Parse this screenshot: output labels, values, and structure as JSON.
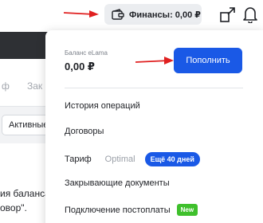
{
  "header": {
    "finance_label": "Финансы: 0,00 ₽"
  },
  "background": {
    "tabs": [
      "ф",
      "Зак"
    ],
    "filter_select": "Активные",
    "text_line_1": "ия баланса",
    "text_line_2": "овор\"."
  },
  "panel": {
    "balance_label": "Баланс eLama",
    "balance_value": "0,00 ₽",
    "topup_label": "Пополнить",
    "menu": {
      "history": "История операций",
      "contracts": "Договоры",
      "tariff_label": "Тариф",
      "tariff_name": "Optimal",
      "tariff_badge": "Ещё 40 дней",
      "closing_docs": "Закрывающие документы",
      "postpay": "Подключение постоплаты",
      "postpay_badge": "New"
    }
  },
  "colors": {
    "accent": "#1a59e6",
    "badge_new": "#3fc02c",
    "arrow": "#e02020"
  }
}
